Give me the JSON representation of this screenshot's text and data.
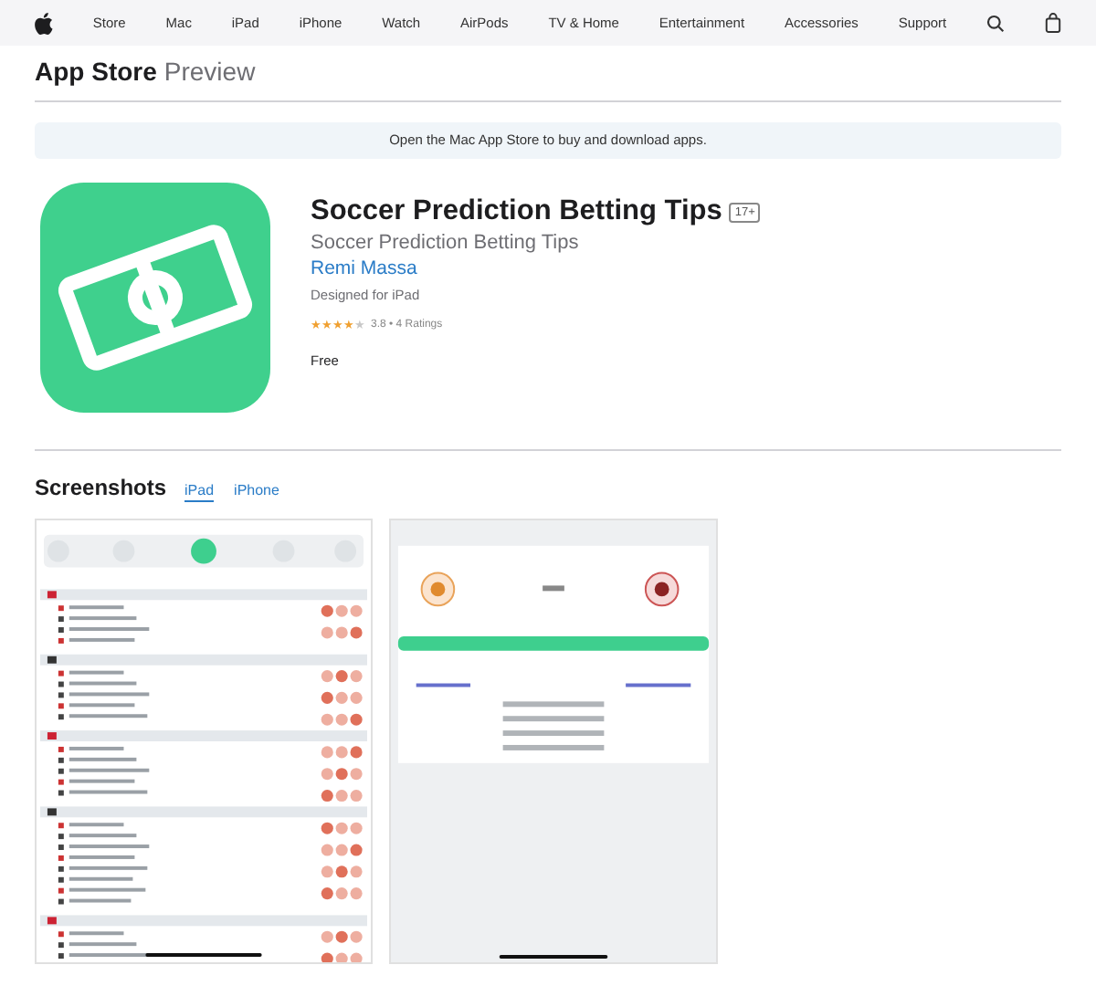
{
  "nav": {
    "items": [
      "Store",
      "Mac",
      "iPad",
      "iPhone",
      "Watch",
      "AirPods",
      "TV & Home",
      "Entertainment",
      "Accessories",
      "Support"
    ]
  },
  "header": {
    "title": "App Store",
    "subtitle": "Preview"
  },
  "banner": "Open the Mac App Store to buy and download apps.",
  "app": {
    "title": "Soccer Prediction Betting Tips",
    "age_badge": "17+",
    "subtitle": "Soccer Prediction Betting Tips",
    "developer": "Remi Massa",
    "designed_for": "Designed for iPad",
    "stars": 4,
    "rating_text": "3.8 • 4 Ratings",
    "price": "Free"
  },
  "screenshots": {
    "title": "Screenshots",
    "tabs": [
      {
        "label": "iPad",
        "selected": true
      },
      {
        "label": "iPhone",
        "selected": false
      }
    ],
    "images": [
      {
        "kind": "list"
      },
      {
        "kind": "detail"
      }
    ]
  }
}
